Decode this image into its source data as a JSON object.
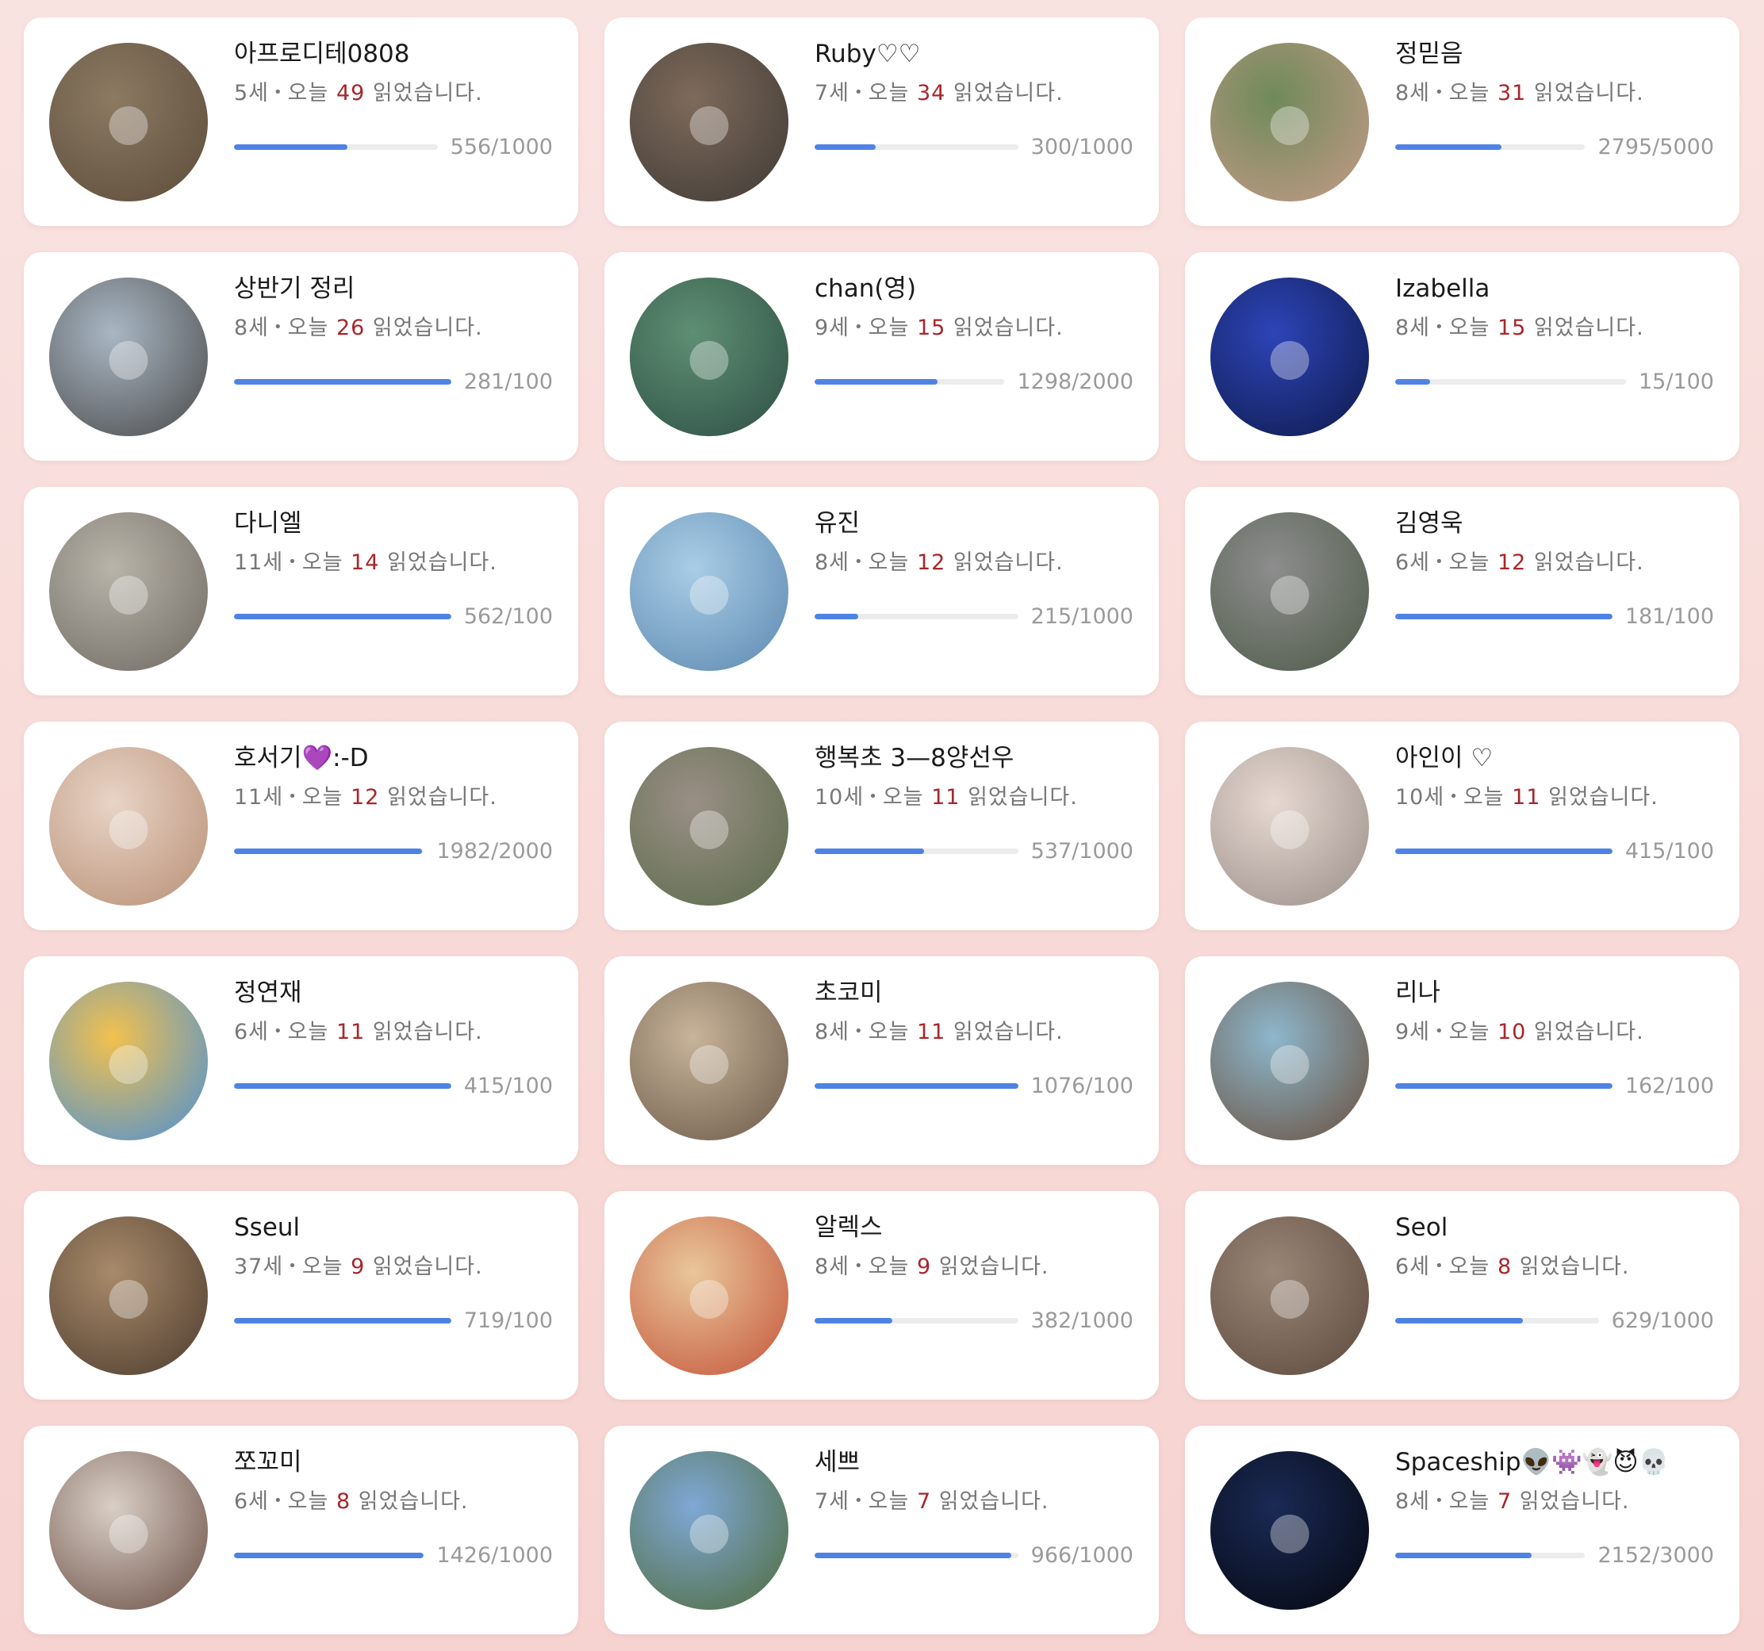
{
  "ui": {
    "today_label": "오늘",
    "read_suffix": "읽었습니다."
  },
  "readers": [
    {
      "name": "아프로디테0808",
      "age": "5세",
      "today": "49",
      "progress_text": "556/1000",
      "progress": 0.556,
      "avatar_icon": "child-photo-icon",
      "avatar_colors": [
        "#8c7a62",
        "#5b4c3a"
      ]
    },
    {
      "name": "Ruby♡♡",
      "age": "7세",
      "today": "34",
      "progress_text": "300/1000",
      "progress": 0.3,
      "avatar_icon": "child-photo-icon",
      "avatar_colors": [
        "#7e6a5a",
        "#3f3a36"
      ]
    },
    {
      "name": "정믿음",
      "age": "8세",
      "today": "31",
      "progress_text": "2795/5000",
      "progress": 0.559,
      "avatar_icon": "child-photo-icon",
      "avatar_colors": [
        "#6f8a5a",
        "#c59a88"
      ]
    },
    {
      "name": "상반기 정리",
      "age": "8세",
      "today": "26",
      "progress_text": "281/100",
      "progress": 1.0,
      "avatar_icon": "seaside-photo-icon",
      "avatar_colors": [
        "#a9b7c4",
        "#4a4a4a"
      ]
    },
    {
      "name": "chan(영)",
      "age": "9세",
      "today": "15",
      "progress_text": "1298/2000",
      "progress": 0.649,
      "avatar_icon": "child-photo-icon",
      "avatar_colors": [
        "#5e8f73",
        "#2e4f45"
      ]
    },
    {
      "name": "Izabella",
      "age": "8세",
      "today": "15",
      "progress_text": "15/100",
      "progress": 0.15,
      "avatar_icon": "aquarium-photo-icon",
      "avatar_colors": [
        "#2d44b8",
        "#0e1a4a"
      ]
    },
    {
      "name": "다니엘",
      "age": "11세",
      "today": "14",
      "progress_text": "562/100",
      "progress": 1.0,
      "avatar_icon": "child-photo-icon",
      "avatar_colors": [
        "#b9b4aa",
        "#6f6a62"
      ]
    },
    {
      "name": "유진",
      "age": "8세",
      "today": "12",
      "progress_text": "215/1000",
      "progress": 0.215,
      "avatar_icon": "snowman-drawing-icon",
      "avatar_colors": [
        "#a9cde6",
        "#5c88b0"
      ]
    },
    {
      "name": "김영욱",
      "age": "6세",
      "today": "12",
      "progress_text": "181/100",
      "progress": 1.0,
      "avatar_icon": "children-walking-photo-icon",
      "avatar_colors": [
        "#8d8d8d",
        "#4e5b48"
      ]
    },
    {
      "name": "호서기💜:-D",
      "age": "11세",
      "today": "12",
      "progress_text": "1982/2000",
      "progress": 0.991,
      "avatar_icon": "selfie-photo-icon",
      "avatar_colors": [
        "#e8d4c6",
        "#b88f75"
      ]
    },
    {
      "name": "행복초 3—8양선우",
      "age": "10세",
      "today": "11",
      "progress_text": "537/1000",
      "progress": 0.537,
      "avatar_icon": "park-photo-icon",
      "avatar_colors": [
        "#9a8f86",
        "#5a6b4a"
      ]
    },
    {
      "name": "아인이 ♡",
      "age": "10세",
      "today": "11",
      "progress_text": "415/100",
      "progress": 1.0,
      "avatar_icon": "plush-toy-photo-icon",
      "avatar_colors": [
        "#e7d9d2",
        "#9a8e88"
      ]
    },
    {
      "name": "정연재",
      "age": "6세",
      "today": "11",
      "progress_text": "415/100",
      "progress": 1.0,
      "avatar_icon": "books-drawing-icon",
      "avatar_colors": [
        "#f2c14e",
        "#4a8fd6"
      ]
    },
    {
      "name": "초코미",
      "age": "8세",
      "today": "11",
      "progress_text": "1076/100",
      "progress": 1.0,
      "avatar_icon": "child-photo-icon",
      "avatar_colors": [
        "#c8b49a",
        "#6b5a48"
      ]
    },
    {
      "name": "리나",
      "age": "9세",
      "today": "10",
      "progress_text": "162/100",
      "progress": 1.0,
      "avatar_icon": "painted-plate-icon",
      "avatar_colors": [
        "#8db7cc",
        "#6a4f3d"
      ]
    },
    {
      "name": "Sseul",
      "age": "37세",
      "today": "9",
      "progress_text": "719/100",
      "progress": 1.0,
      "avatar_icon": "bookshelf-photo-icon",
      "avatar_colors": [
        "#a88a6a",
        "#4d3c2e"
      ]
    },
    {
      "name": "알렉스",
      "age": "8세",
      "today": "9",
      "progress_text": "382/1000",
      "progress": 0.382,
      "avatar_icon": "book-cover-icon",
      "avatar_colors": [
        "#e9c79a",
        "#c4543a"
      ]
    },
    {
      "name": "Seol",
      "age": "6세",
      "today": "8",
      "progress_text": "629/1000",
      "progress": 0.629,
      "avatar_icon": "panda-statue-photo-icon",
      "avatar_colors": [
        "#9a8676",
        "#5c4a3e"
      ]
    },
    {
      "name": "쪼꼬미",
      "age": "6세",
      "today": "8",
      "progress_text": "1426/1000",
      "progress": 1.0,
      "avatar_icon": "child-photo-icon",
      "avatar_colors": [
        "#d9cfc6",
        "#6b4f45"
      ]
    },
    {
      "name": "세쁘",
      "age": "7세",
      "today": "7",
      "progress_text": "966/1000",
      "progress": 0.966,
      "avatar_icon": "pond-photo-icon",
      "avatar_colors": [
        "#7fa8d6",
        "#4f6b3a"
      ]
    },
    {
      "name": "Spaceship👽👾👻😈💀",
      "age": "8세",
      "today": "7",
      "progress_text": "2152/3000",
      "progress": 0.717,
      "avatar_icon": "rocket-launch-icon",
      "avatar_colors": [
        "#1a2a55",
        "#05070f"
      ]
    }
  ]
}
